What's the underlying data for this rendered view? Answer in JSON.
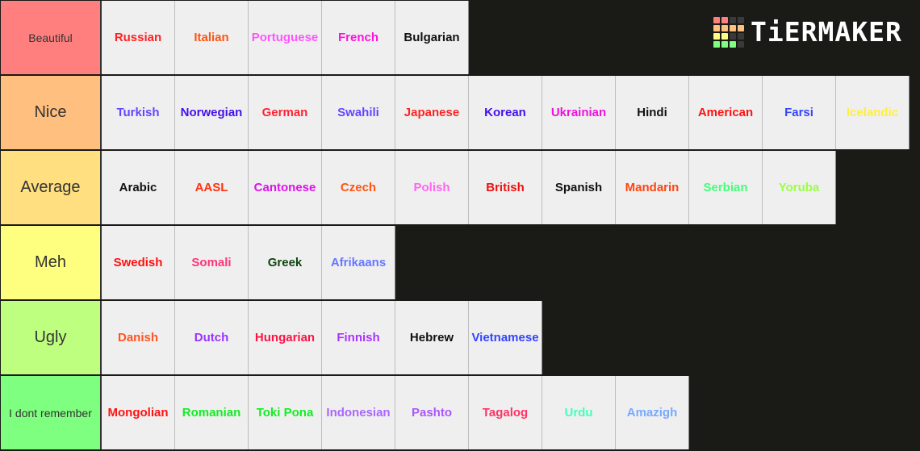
{
  "logo": {
    "text": "TiERMAKER",
    "grid_colors": [
      "#ff7f7f",
      "#ff7f7f",
      "#3a3a3a",
      "#3a3a3a",
      "#ffbf7f",
      "#ffbf7f",
      "#ffbf7f",
      "#ffbf7f",
      "#ffff7f",
      "#ffff7f",
      "#3a3a3a",
      "#3a3a3a",
      "#7fff7f",
      "#7fff7f",
      "#7fff7f",
      "#3a3a3a"
    ]
  },
  "tiers": [
    {
      "label": "Beautiful",
      "color": "#ff7f7f",
      "small": true,
      "items": [
        {
          "text": "Russian",
          "color": "#ff2222"
        },
        {
          "text": "Italian",
          "color": "#ff5511"
        },
        {
          "text": "Portuguese",
          "color": "#ff55ff"
        },
        {
          "text": "French",
          "color": "#ff11dd"
        },
        {
          "text": "Bulgarian",
          "color": "#111111"
        }
      ]
    },
    {
      "label": "Nice",
      "color": "#ffbf7f",
      "small": false,
      "items": [
        {
          "text": "Turkish",
          "color": "#6644ff"
        },
        {
          "text": "Norwegian",
          "color": "#4411ee"
        },
        {
          "text": "German",
          "color": "#ff2233"
        },
        {
          "text": "Swahili",
          "color": "#6644ff"
        },
        {
          "text": "Japanese",
          "color": "#ff2222"
        },
        {
          "text": "Korean",
          "color": "#4411ee"
        },
        {
          "text": "Ukrainian",
          "color": "#ee11dd"
        },
        {
          "text": "Hindi",
          "color": "#111111"
        },
        {
          "text": "American",
          "color": "#ff1111"
        },
        {
          "text": "Farsi",
          "color": "#3344ff"
        },
        {
          "text": "Icelandic",
          "color": "#ffee44"
        }
      ]
    },
    {
      "label": "Average",
      "color": "#ffdf7f",
      "small": false,
      "items": [
        {
          "text": "Arabic",
          "color": "#111111"
        },
        {
          "text": "AASL",
          "color": "#ff3311"
        },
        {
          "text": "Cantonese",
          "color": "#dd11ee"
        },
        {
          "text": "Czech",
          "color": "#ff5511"
        },
        {
          "text": "Polish",
          "color": "#ff66ee"
        },
        {
          "text": "British",
          "color": "#ee1111"
        },
        {
          "text": "Spanish",
          "color": "#111111"
        },
        {
          "text": "Mandarin",
          "color": "#ff4411"
        },
        {
          "text": "Serbian",
          "color": "#44ff77"
        },
        {
          "text": "Yoruba",
          "color": "#99ff44"
        }
      ]
    },
    {
      "label": "Meh",
      "color": "#ffff7f",
      "small": false,
      "items": [
        {
          "text": "Swedish",
          "color": "#ff1111"
        },
        {
          "text": "Somali",
          "color": "#ff3377"
        },
        {
          "text": "Greek",
          "color": "#114411"
        },
        {
          "text": "Afrikaans",
          "color": "#6677ff"
        }
      ]
    },
    {
      "label": "Ugly",
      "color": "#bfff7f",
      "small": false,
      "items": [
        {
          "text": "Danish",
          "color": "#ff5522"
        },
        {
          "text": "Dutch",
          "color": "#9933ff"
        },
        {
          "text": "Hungarian",
          "color": "#ff1144"
        },
        {
          "text": "Finnish",
          "color": "#aa33ff"
        },
        {
          "text": "Hebrew",
          "color": "#111111"
        },
        {
          "text": "Vietnamese",
          "color": "#3344ff"
        }
      ]
    },
    {
      "label": "I dont remember",
      "color": "#7fff7f",
      "small": true,
      "items": [
        {
          "text": "Mongolian",
          "color": "#ff1111"
        },
        {
          "text": "Romanian",
          "color": "#11ee22"
        },
        {
          "text": "Toki Pona",
          "color": "#11ee22"
        },
        {
          "text": "Indonesian",
          "color": "#aa66ff"
        },
        {
          "text": "Pashto",
          "color": "#aa55ff"
        },
        {
          "text": "Tagalog",
          "color": "#ff3366"
        },
        {
          "text": "Urdu",
          "color": "#44ffbb"
        },
        {
          "text": "Amazigh",
          "color": "#77aaff"
        }
      ]
    }
  ]
}
